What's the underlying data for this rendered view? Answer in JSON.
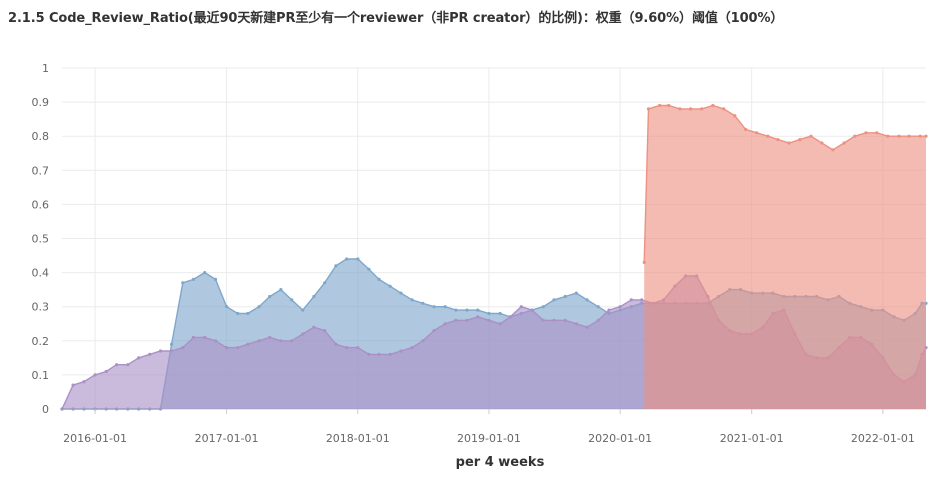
{
  "chart_data": {
    "type": "area",
    "title": "2.1.5 Code_Review_Ratio(最近90天新建PR至少有一个reviewer（非PR creator）的比例)：权重（9.60%）阈值（100%）",
    "xlabel": "per 4 weeks",
    "ylabel": "",
    "ylim": [
      0,
      1
    ],
    "yticks": [
      "0",
      "0.1",
      "0.2",
      "0.3",
      "0.4",
      "0.5",
      "0.6",
      "0.7",
      "0.8",
      "0.9",
      "1"
    ],
    "xticks": [
      "2016-01-01",
      "2017-01-01",
      "2018-01-01",
      "2019-01-01",
      "2020-01-01",
      "2021-01-01",
      "2022-01-01"
    ],
    "xrange": [
      "2015-10-01",
      "2022-05-01"
    ],
    "grid": true,
    "series": [
      {
        "color": "#7fa7cc",
        "points": [
          [
            "2015-10-01",
            0
          ],
          [
            "2015-11-01",
            0
          ],
          [
            "2015-12-01",
            0
          ],
          [
            "2016-01-01",
            0
          ],
          [
            "2016-02-01",
            0
          ],
          [
            "2016-03-01",
            0
          ],
          [
            "2016-04-01",
            0
          ],
          [
            "2016-05-01",
            0
          ],
          [
            "2016-06-01",
            0
          ],
          [
            "2016-07-01",
            0
          ],
          [
            "2016-08-01",
            0.19
          ],
          [
            "2016-09-01",
            0.37
          ],
          [
            "2016-10-01",
            0.38
          ],
          [
            "2016-11-01",
            0.4
          ],
          [
            "2016-12-01",
            0.38
          ],
          [
            "2017-01-01",
            0.3
          ],
          [
            "2017-02-01",
            0.28
          ],
          [
            "2017-03-01",
            0.28
          ],
          [
            "2017-04-01",
            0.3
          ],
          [
            "2017-05-01",
            0.33
          ],
          [
            "2017-06-01",
            0.35
          ],
          [
            "2017-07-01",
            0.32
          ],
          [
            "2017-08-01",
            0.29
          ],
          [
            "2017-09-01",
            0.33
          ],
          [
            "2017-10-01",
            0.37
          ],
          [
            "2017-11-01",
            0.42
          ],
          [
            "2017-12-01",
            0.44
          ],
          [
            "2018-01-01",
            0.44
          ],
          [
            "2018-02-01",
            0.41
          ],
          [
            "2018-03-01",
            0.38
          ],
          [
            "2018-04-01",
            0.36
          ],
          [
            "2018-05-01",
            0.34
          ],
          [
            "2018-06-01",
            0.32
          ],
          [
            "2018-07-01",
            0.31
          ],
          [
            "2018-08-01",
            0.3
          ],
          [
            "2018-09-01",
            0.3
          ],
          [
            "2018-10-01",
            0.29
          ],
          [
            "2018-11-01",
            0.29
          ],
          [
            "2018-12-01",
            0.29
          ],
          [
            "2019-01-01",
            0.28
          ],
          [
            "2019-02-01",
            0.28
          ],
          [
            "2019-03-01",
            0.27
          ],
          [
            "2019-04-01",
            0.28
          ],
          [
            "2019-05-01",
            0.29
          ],
          [
            "2019-06-01",
            0.3
          ],
          [
            "2019-07-01",
            0.32
          ],
          [
            "2019-08-01",
            0.33
          ],
          [
            "2019-09-01",
            0.34
          ],
          [
            "2019-10-01",
            0.32
          ],
          [
            "2019-11-01",
            0.3
          ],
          [
            "2019-12-01",
            0.28
          ],
          [
            "2020-01-01",
            0.29
          ],
          [
            "2020-02-01",
            0.3
          ],
          [
            "2020-03-01",
            0.31
          ],
          [
            "2020-04-01",
            0.31
          ],
          [
            "2020-05-01",
            0.31
          ],
          [
            "2020-06-01",
            0.31
          ],
          [
            "2020-07-01",
            0.31
          ],
          [
            "2020-08-01",
            0.31
          ],
          [
            "2020-09-01",
            0.31
          ],
          [
            "2020-10-01",
            0.33
          ],
          [
            "2020-11-01",
            0.35
          ],
          [
            "2020-12-01",
            0.35
          ],
          [
            "2021-01-01",
            0.34
          ],
          [
            "2021-02-01",
            0.34
          ],
          [
            "2021-03-01",
            0.34
          ],
          [
            "2021-04-01",
            0.33
          ],
          [
            "2021-05-01",
            0.33
          ],
          [
            "2021-06-01",
            0.33
          ],
          [
            "2021-07-01",
            0.33
          ],
          [
            "2021-08-01",
            0.32
          ],
          [
            "2021-09-01",
            0.33
          ],
          [
            "2021-10-01",
            0.31
          ],
          [
            "2021-11-01",
            0.3
          ],
          [
            "2021-12-01",
            0.29
          ],
          [
            "2022-01-01",
            0.29
          ],
          [
            "2022-02-01",
            0.27
          ],
          [
            "2022-03-01",
            0.26
          ],
          [
            "2022-04-01",
            0.28
          ],
          [
            "2022-04-20",
            0.31
          ],
          [
            "2022-05-01",
            0.31
          ]
        ]
      },
      {
        "color": "#a991c6",
        "points": [
          [
            "2015-10-01",
            0
          ],
          [
            "2015-11-01",
            0.07
          ],
          [
            "2015-12-01",
            0.08
          ],
          [
            "2016-01-01",
            0.1
          ],
          [
            "2016-02-01",
            0.11
          ],
          [
            "2016-03-01",
            0.13
          ],
          [
            "2016-04-01",
            0.13
          ],
          [
            "2016-05-01",
            0.15
          ],
          [
            "2016-06-01",
            0.16
          ],
          [
            "2016-07-01",
            0.17
          ],
          [
            "2016-08-01",
            0.17
          ],
          [
            "2016-09-01",
            0.18
          ],
          [
            "2016-10-01",
            0.21
          ],
          [
            "2016-11-01",
            0.21
          ],
          [
            "2016-12-01",
            0.2
          ],
          [
            "2017-01-01",
            0.18
          ],
          [
            "2017-02-01",
            0.18
          ],
          [
            "2017-03-01",
            0.19
          ],
          [
            "2017-04-01",
            0.2
          ],
          [
            "2017-05-01",
            0.21
          ],
          [
            "2017-06-01",
            0.2
          ],
          [
            "2017-07-01",
            0.2
          ],
          [
            "2017-08-01",
            0.22
          ],
          [
            "2017-09-01",
            0.24
          ],
          [
            "2017-10-01",
            0.23
          ],
          [
            "2017-11-01",
            0.19
          ],
          [
            "2017-12-01",
            0.18
          ],
          [
            "2018-01-01",
            0.18
          ],
          [
            "2018-02-01",
            0.16
          ],
          [
            "2018-03-01",
            0.16
          ],
          [
            "2018-04-01",
            0.16
          ],
          [
            "2018-05-01",
            0.17
          ],
          [
            "2018-06-01",
            0.18
          ],
          [
            "2018-07-01",
            0.2
          ],
          [
            "2018-08-01",
            0.23
          ],
          [
            "2018-09-01",
            0.25
          ],
          [
            "2018-10-01",
            0.26
          ],
          [
            "2018-11-01",
            0.26
          ],
          [
            "2018-12-01",
            0.27
          ],
          [
            "2019-01-01",
            0.26
          ],
          [
            "2019-02-01",
            0.25
          ],
          [
            "2019-03-01",
            0.27
          ],
          [
            "2019-04-01",
            0.3
          ],
          [
            "2019-05-01",
            0.29
          ],
          [
            "2019-06-01",
            0.26
          ],
          [
            "2019-07-01",
            0.26
          ],
          [
            "2019-08-01",
            0.26
          ],
          [
            "2019-09-01",
            0.25
          ],
          [
            "2019-10-01",
            0.24
          ],
          [
            "2019-11-01",
            0.26
          ],
          [
            "2019-12-01",
            0.29
          ],
          [
            "2020-01-01",
            0.3
          ],
          [
            "2020-02-01",
            0.32
          ],
          [
            "2020-03-01",
            0.32
          ],
          [
            "2020-04-01",
            0.31
          ],
          [
            "2020-05-01",
            0.32
          ],
          [
            "2020-06-01",
            0.36
          ],
          [
            "2020-07-01",
            0.39
          ],
          [
            "2020-08-01",
            0.39
          ],
          [
            "2020-09-01",
            0.33
          ],
          [
            "2020-10-01",
            0.26
          ],
          [
            "2020-11-01",
            0.23
          ],
          [
            "2020-12-01",
            0.22
          ],
          [
            "2021-01-01",
            0.22
          ],
          [
            "2021-02-01",
            0.24
          ],
          [
            "2021-03-01",
            0.28
          ],
          [
            "2021-04-01",
            0.29
          ],
          [
            "2021-05-01",
            0.22
          ],
          [
            "2021-06-01",
            0.16
          ],
          [
            "2021-07-01",
            0.15
          ],
          [
            "2021-08-01",
            0.15
          ],
          [
            "2021-09-01",
            0.18
          ],
          [
            "2021-10-01",
            0.21
          ],
          [
            "2021-11-01",
            0.21
          ],
          [
            "2021-12-01",
            0.19
          ],
          [
            "2022-01-01",
            0.15
          ],
          [
            "2022-02-01",
            0.1
          ],
          [
            "2022-03-01",
            0.08
          ],
          [
            "2022-04-01",
            0.1
          ],
          [
            "2022-04-20",
            0.16
          ],
          [
            "2022-05-01",
            0.18
          ]
        ]
      },
      {
        "color": "#ec9282",
        "points": [
          [
            "2020-03-08",
            0.43
          ],
          [
            "2020-03-20",
            0.88
          ],
          [
            "2020-04-20",
            0.89
          ],
          [
            "2020-05-15",
            0.89
          ],
          [
            "2020-06-15",
            0.88
          ],
          [
            "2020-07-15",
            0.88
          ],
          [
            "2020-08-15",
            0.88
          ],
          [
            "2020-09-15",
            0.89
          ],
          [
            "2020-10-15",
            0.88
          ],
          [
            "2020-11-15",
            0.86
          ],
          [
            "2020-12-15",
            0.82
          ],
          [
            "2021-01-15",
            0.81
          ],
          [
            "2021-02-15",
            0.8
          ],
          [
            "2021-03-15",
            0.79
          ],
          [
            "2021-04-15",
            0.78
          ],
          [
            "2021-05-15",
            0.79
          ],
          [
            "2021-06-15",
            0.8
          ],
          [
            "2021-07-15",
            0.78
          ],
          [
            "2021-08-15",
            0.76
          ],
          [
            "2021-09-15",
            0.78
          ],
          [
            "2021-10-15",
            0.8
          ],
          [
            "2021-11-15",
            0.81
          ],
          [
            "2021-12-15",
            0.81
          ],
          [
            "2022-01-15",
            0.8
          ],
          [
            "2022-02-15",
            0.8
          ],
          [
            "2022-03-15",
            0.8
          ],
          [
            "2022-04-15",
            0.8
          ],
          [
            "2022-05-01",
            0.8
          ]
        ]
      }
    ]
  }
}
